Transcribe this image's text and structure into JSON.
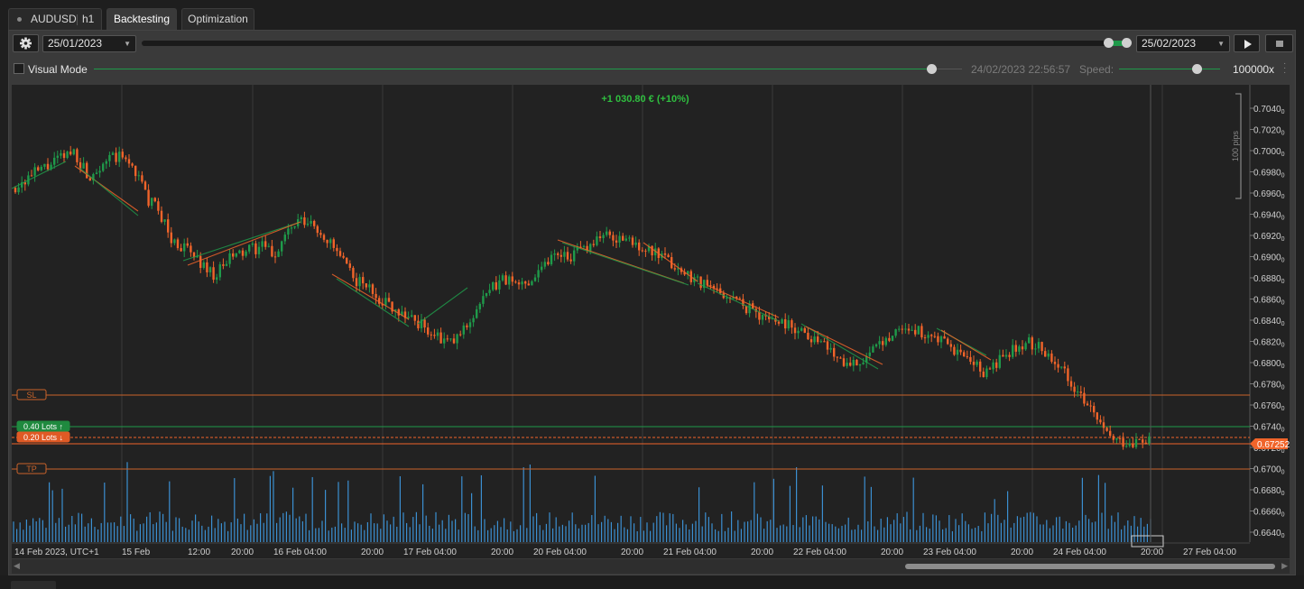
{
  "tabs": [
    {
      "symbol": "AUDUSD",
      "timeframe": "h1"
    },
    {
      "label": "Backtesting"
    },
    {
      "label": "Optimization"
    }
  ],
  "controls": {
    "start_date": "25/01/2023",
    "end_date": "25/02/2023",
    "visual_mode_label": "Visual Mode",
    "timestamp": "24/02/2023 22:56:57",
    "speed_label": "Speed:",
    "speed_value": "100000x",
    "progress": 1.0,
    "visual_progress": 0.96
  },
  "chart": {
    "profit_label": "+1 030.80 € (+10%)",
    "scale_label": "100 pips",
    "sl_label": "SL",
    "tp_label": "TP",
    "buy_lots": "0.40 Lots",
    "sell_lots": "0.20 Lots",
    "current_price": "0.67252",
    "y_ticks": [
      "0.70400",
      "0.70200",
      "0.70000",
      "0.69800",
      "0.69600",
      "0.69400",
      "0.69200",
      "0.69000",
      "0.68800",
      "0.68600",
      "0.68400",
      "0.68200",
      "0.68000",
      "0.67800",
      "0.67600",
      "0.67400",
      "0.67200",
      "0.67000",
      "0.66800",
      "0.66600",
      "0.66400"
    ],
    "x_ticks": [
      "14 Feb 2023, UTC+1",
      "15 Feb",
      "12:00",
      "20:00",
      "16 Feb 04:00",
      "20:00",
      "17 Feb 04:00",
      "20:00",
      "20 Feb 04:00",
      "20:00",
      "21 Feb 04:00",
      "20:00",
      "22 Feb 04:00",
      "20:00",
      "23 Feb 04:00",
      "20:00",
      "24 Feb 04:00",
      "20:00",
      "27 Feb 04:00"
    ],
    "colors": {
      "up": "#1f9a4a",
      "down": "#f0642a",
      "volume": "#3b8fd1",
      "profit": "#2fbf3f",
      "sl": "#c9632a",
      "grid": "#3a3a3a"
    }
  },
  "chart_data": {
    "type": "candlestick",
    "symbol": "AUDUSD",
    "timeframe": "h1",
    "price_range": [
      0.6636,
      0.7052
    ],
    "close_path": [
      [
        0,
        0.6965
      ],
      [
        12,
        0.6978
      ],
      [
        25,
        0.699
      ],
      [
        35,
        0.7
      ],
      [
        44,
        0.6975
      ],
      [
        52,
        0.699
      ],
      [
        62,
        0.6994
      ],
      [
        70,
        0.6985
      ],
      [
        78,
        0.6955
      ],
      [
        86,
        0.694
      ],
      [
        92,
        0.6915
      ],
      [
        100,
        0.6908
      ],
      [
        110,
        0.6893
      ],
      [
        118,
        0.6882
      ],
      [
        126,
        0.6898
      ],
      [
        136,
        0.6905
      ],
      [
        146,
        0.691
      ],
      [
        152,
        0.69
      ],
      [
        158,
        0.692
      ],
      [
        166,
        0.6932
      ],
      [
        174,
        0.693
      ],
      [
        182,
        0.6918
      ],
      [
        190,
        0.69
      ],
      [
        198,
        0.688
      ],
      [
        206,
        0.6872
      ],
      [
        214,
        0.686
      ],
      [
        224,
        0.685
      ],
      [
        232,
        0.6842
      ],
      [
        240,
        0.6833
      ],
      [
        248,
        0.6822
      ],
      [
        256,
        0.6818
      ],
      [
        262,
        0.683
      ],
      [
        270,
        0.685
      ],
      [
        278,
        0.6868
      ],
      [
        286,
        0.688
      ],
      [
        294,
        0.6872
      ],
      [
        302,
        0.688
      ],
      [
        310,
        0.6895
      ],
      [
        318,
        0.6905
      ],
      [
        326,
        0.69
      ],
      [
        334,
        0.691
      ],
      [
        342,
        0.692
      ],
      [
        350,
        0.6918
      ],
      [
        358,
        0.6915
      ],
      [
        366,
        0.691
      ],
      [
        374,
        0.6902
      ],
      [
        382,
        0.6895
      ],
      [
        390,
        0.6885
      ],
      [
        398,
        0.688
      ],
      [
        406,
        0.687
      ],
      [
        414,
        0.6865
      ],
      [
        422,
        0.6858
      ],
      [
        430,
        0.685
      ],
      [
        438,
        0.6843
      ],
      [
        446,
        0.684
      ],
      [
        454,
        0.6835
      ],
      [
        462,
        0.6828
      ],
      [
        470,
        0.682
      ],
      [
        478,
        0.681
      ],
      [
        486,
        0.68
      ],
      [
        494,
        0.6802
      ],
      [
        502,
        0.681
      ],
      [
        510,
        0.6825
      ],
      [
        518,
        0.6834
      ],
      [
        526,
        0.683
      ],
      [
        534,
        0.6825
      ],
      [
        542,
        0.6818
      ],
      [
        550,
        0.681
      ],
      [
        558,
        0.68
      ],
      [
        566,
        0.679
      ],
      [
        574,
        0.68
      ],
      [
        582,
        0.681
      ],
      [
        590,
        0.682
      ],
      [
        598,
        0.6815
      ],
      [
        606,
        0.6805
      ],
      [
        614,
        0.679
      ],
      [
        622,
        0.677
      ],
      [
        630,
        0.675
      ],
      [
        638,
        0.673
      ],
      [
        646,
        0.6725
      ],
      [
        654,
        0.6726
      ],
      [
        662,
        0.6725
      ]
    ],
    "volume_range": [
      0,
      100
    ]
  }
}
